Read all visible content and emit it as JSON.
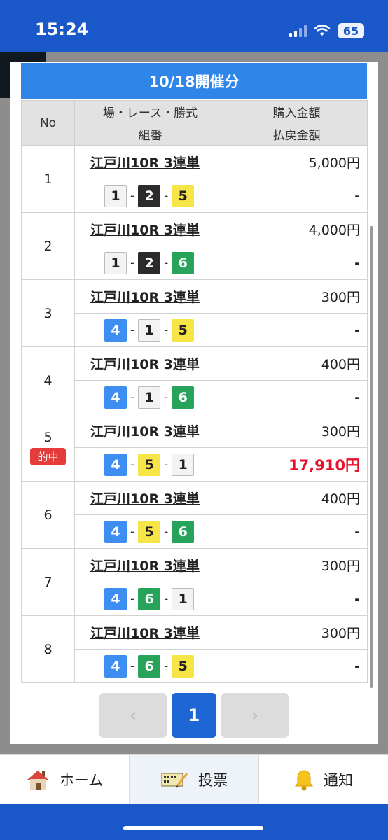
{
  "status": {
    "time": "15:24",
    "battery": "65"
  },
  "header": {
    "title": "10/18開催分"
  },
  "table": {
    "col_no": "No",
    "col_race": "場・レース・勝式",
    "col_combo": "組番",
    "col_amount": "購入金額",
    "col_payout": "払戻金額"
  },
  "rows": [
    {
      "no": "1",
      "race": "江戸川10R 3連単",
      "combo": [
        "1",
        "2",
        "5"
      ],
      "amount": "5,000円",
      "payout": "-"
    },
    {
      "no": "2",
      "race": "江戸川10R 3連単",
      "combo": [
        "1",
        "2",
        "6"
      ],
      "amount": "4,000円",
      "payout": "-"
    },
    {
      "no": "3",
      "race": "江戸川10R 3連単",
      "combo": [
        "4",
        "1",
        "5"
      ],
      "amount": "300円",
      "payout": "-"
    },
    {
      "no": "4",
      "race": "江戸川10R 3連単",
      "combo": [
        "4",
        "1",
        "6"
      ],
      "amount": "400円",
      "payout": "-"
    },
    {
      "no": "5",
      "race": "江戸川10R 3連単",
      "combo": [
        "4",
        "5",
        "1"
      ],
      "amount": "300円",
      "payout": "17,910円",
      "badge": "的中"
    },
    {
      "no": "6",
      "race": "江戸川10R 3連単",
      "combo": [
        "4",
        "5",
        "6"
      ],
      "amount": "400円",
      "payout": "-"
    },
    {
      "no": "7",
      "race": "江戸川10R 3連単",
      "combo": [
        "4",
        "6",
        "1"
      ],
      "amount": "300円",
      "payout": "-"
    },
    {
      "no": "8",
      "race": "江戸川10R 3連単",
      "combo": [
        "4",
        "6",
        "5"
      ],
      "amount": "300円",
      "payout": "-"
    }
  ],
  "boat_colors": {
    "1": {
      "bg": "#f3f3f3",
      "fg": "#222222",
      "border": "#bbbbbb"
    },
    "2": {
      "bg": "#2b2b2b",
      "fg": "#ffffff",
      "border": "#2b2b2b"
    },
    "3": {
      "bg": "#e53b3b",
      "fg": "#ffffff",
      "border": "#e53b3b"
    },
    "4": {
      "bg": "#3d8ef0",
      "fg": "#ffffff",
      "border": "#3d8ef0"
    },
    "5": {
      "bg": "#f7e447",
      "fg": "#222222",
      "border": "#f7e447"
    },
    "6": {
      "bg": "#27a35a",
      "fg": "#ffffff",
      "border": "#27a35a"
    }
  },
  "pager": {
    "prev": "‹",
    "current": "1",
    "next": "›"
  },
  "tabs": [
    {
      "label": "ホーム",
      "icon": "home-icon"
    },
    {
      "label": "投票",
      "icon": "ticket-icon"
    },
    {
      "label": "通知",
      "icon": "bell-icon"
    }
  ]
}
